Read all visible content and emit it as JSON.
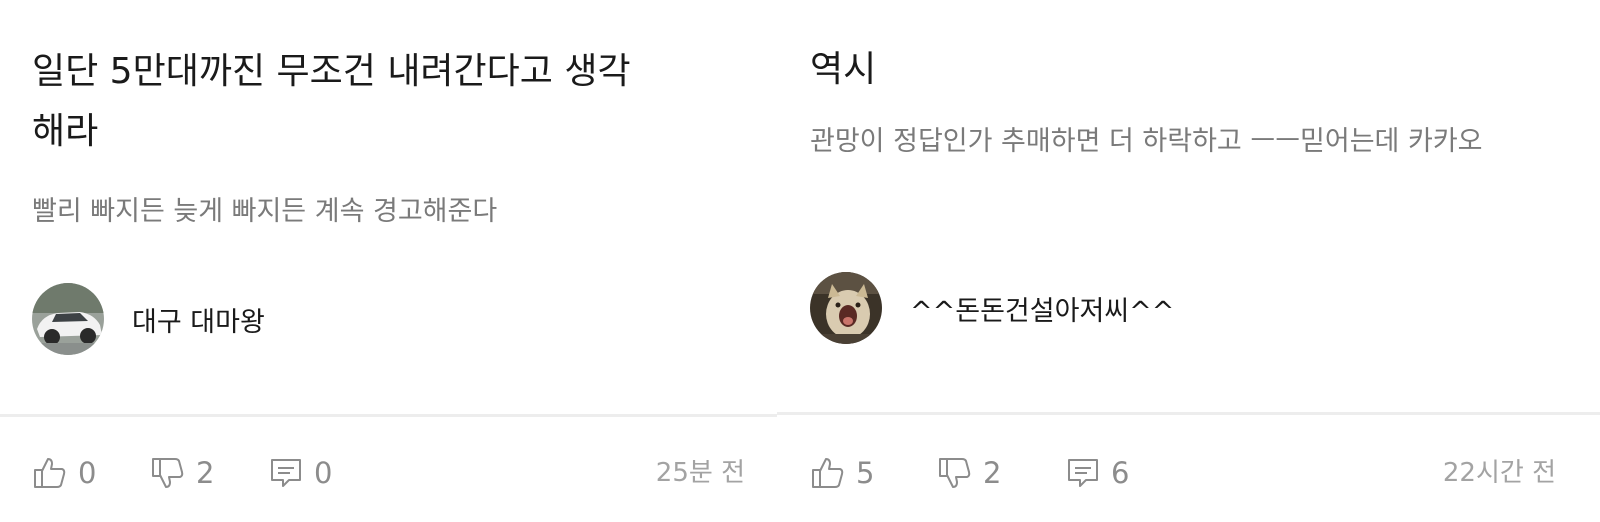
{
  "posts": [
    {
      "title": "일단 5만대까진 무조건 내려간다고 생각해라",
      "body": "빨리 빠지든 늦게 빠지든 계속 경고해준다",
      "author": {
        "name": "대구 대마왕",
        "avatar_icon": "car-avatar-icon"
      },
      "actions": {
        "likes": "0",
        "dislikes": "2",
        "comments": "0"
      },
      "timestamp": "25분 전"
    },
    {
      "title": "역시",
      "body": "관망이 정답인가 추매하면 더 하락하고 ㅡㅡ믿어는데 카카오",
      "author": {
        "name": "^^돈돈건설아저씨^^",
        "avatar_icon": "cat-avatar-icon"
      },
      "actions": {
        "likes": "5",
        "dislikes": "2",
        "comments": "6"
      },
      "timestamp": "22시간 전"
    }
  ],
  "colors": {
    "title": "#1a1a1a",
    "body": "#7a7a7a",
    "meta": "#8c8c8c",
    "timestamp": "#a3a3a3",
    "divider": "#ededed"
  }
}
